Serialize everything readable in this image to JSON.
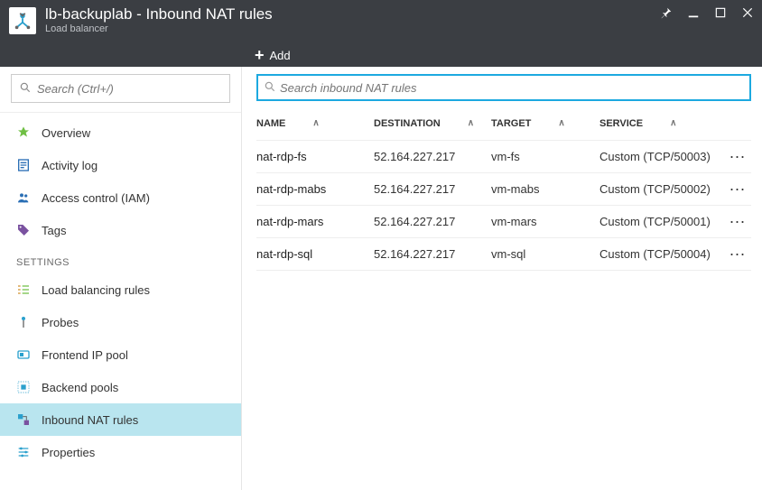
{
  "header": {
    "title": "lb-backuplab - Inbound NAT rules",
    "subtitle": "Load balancer"
  },
  "toolbar": {
    "add_label": "Add"
  },
  "sidebar": {
    "search_placeholder": "Search (Ctrl+/)",
    "items": [
      {
        "label": "Overview"
      },
      {
        "label": "Activity log"
      },
      {
        "label": "Access control (IAM)"
      },
      {
        "label": "Tags"
      }
    ],
    "section_label": "SETTINGS",
    "settings_items": [
      {
        "label": "Load balancing rules"
      },
      {
        "label": "Probes"
      },
      {
        "label": "Frontend IP pool"
      },
      {
        "label": "Backend pools"
      },
      {
        "label": "Inbound NAT rules"
      },
      {
        "label": "Properties"
      }
    ]
  },
  "main": {
    "search_placeholder": "Search inbound NAT rules",
    "columns": {
      "name": "NAME",
      "destination": "DESTINATION",
      "target": "TARGET",
      "service": "SERVICE"
    },
    "rows": [
      {
        "name": "nat-rdp-fs",
        "destination": "52.164.227.217",
        "target": "vm-fs",
        "service": "Custom (TCP/50003)"
      },
      {
        "name": "nat-rdp-mabs",
        "destination": "52.164.227.217",
        "target": "vm-mabs",
        "service": "Custom (TCP/50002)"
      },
      {
        "name": "nat-rdp-mars",
        "destination": "52.164.227.217",
        "target": "vm-mars",
        "service": "Custom (TCP/50001)"
      },
      {
        "name": "nat-rdp-sql",
        "destination": "52.164.227.217",
        "target": "vm-sql",
        "service": "Custom (TCP/50004)"
      }
    ]
  },
  "colors": {
    "header_bg": "#3b3e43",
    "accent": "#1ca9e0",
    "selected_bg": "#b9e5ef"
  }
}
